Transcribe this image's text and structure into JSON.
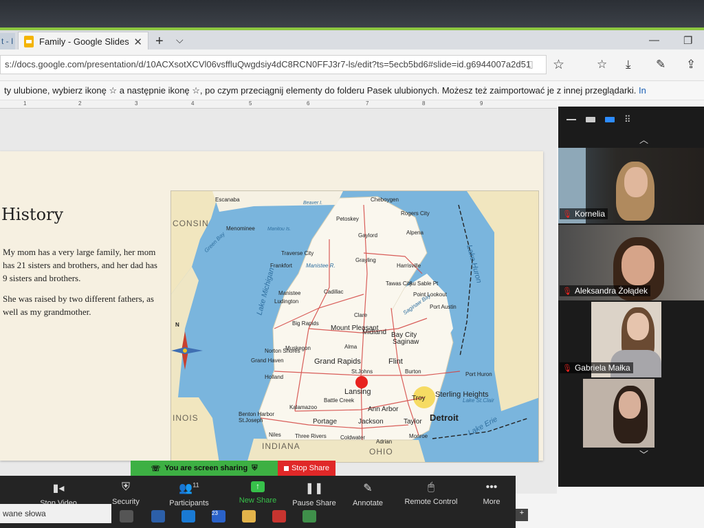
{
  "browser": {
    "tab_stub": "t - I",
    "tab_title": "Family - Google Slides",
    "tab_close": "✕",
    "new_tab": "+",
    "tab_menu": "⌵",
    "minimize": "—",
    "restore": "❐",
    "url": "s://docs.google.com/presentation/d/10ACXsotXCVl06vsffluQwgdsiy4dC8RCN0FFJ3r7-ls/edit?ts=5ecb5bd6#slide=id.g6944007a2d51",
    "favorites_hint": "ty ulubione, wybierz ikonę ☆ a następnie ikonę ☆, po czym przeciągnij elementy do folderu Pasek ulubionych. Możesz też zaimportować je z innej przeglądarki.",
    "favorites_link": "In",
    "icons": [
      "star-icon",
      "favorites-icon",
      "download-icon",
      "pen-icon",
      "share-icon"
    ]
  },
  "ruler": {
    "marks": [
      "1",
      "2",
      "3",
      "4",
      "5",
      "6",
      "7",
      "8",
      "9"
    ]
  },
  "slide": {
    "title": "History",
    "paragraph1": "My mom has a very large family, her mom has 21 sisters and brothers, and her dad has 9 sisters and brothers.",
    "paragraph2": "She was raised by two different fathers, as well as my grandmother."
  },
  "map": {
    "cities": [
      "Cheboygen",
      "Rogers City",
      "Petoskey",
      "Gaylord",
      "Alpena",
      "Traverse City",
      "Grayling",
      "Harrisville",
      "Frankfort",
      "Cadillac",
      "Tawas City",
      "Manistee",
      "Ludington",
      "Big Rapids",
      "Clare",
      "Mount Pleasant",
      "Midland",
      "Bay City",
      "Saginaw",
      "Norton Shores",
      "Grand Haven",
      "Muskegon",
      "Grand Rapids",
      "Flint",
      "Burton",
      "Holland",
      "St.Johns",
      "Lansing",
      "Port Huron",
      "Sterling Heights",
      "Troy",
      "Detroit",
      "Battle Creek",
      "Kalamazoo",
      "Ann Arbor",
      "Benton Harbor St.Joseph",
      "Portage",
      "Jackson",
      "Taylor",
      "Niles",
      "Three Rivers",
      "Coldwater",
      "Adrian",
      "Monroe",
      "Menominee",
      "Escanaba",
      "Alma",
      "Au Sable Pt",
      "Port Austin",
      "Point Lookout"
    ],
    "water": [
      "Lake Michigan",
      "Lake Huron",
      "Lake Erie",
      "Lake St.Clair",
      "Green Bay",
      "Manistee R.",
      "Saginaw Bay",
      "Manitou Is.",
      "Beaver I."
    ],
    "states": [
      "CONSIN",
      "INOIS",
      "INDIANA",
      "OHIO"
    ],
    "compass": "N",
    "highlighted_city": "Lansing"
  },
  "zoom": {
    "view_icons": [
      "minimize-icon",
      "speaker-view-icon",
      "active-gallery-icon",
      "grid-view-icon"
    ],
    "participants": [
      {
        "name": "Kornelia",
        "muted": true
      },
      {
        "name": "Aleksandra Żołądek",
        "muted": true
      },
      {
        "name": "Gabriela Małka",
        "muted": true
      },
      {
        "name": "",
        "muted": false
      }
    ],
    "banner_sharing": "You are screen sharing",
    "banner_stop": "Stop Share",
    "toolbar": {
      "stop_video": "Stop Video",
      "security": "Security",
      "participants": "Participants",
      "participants_count": "11",
      "new_share": "New Share",
      "pause_share": "Pause Share",
      "annotate": "Annotate",
      "remote_control": "Remote Control",
      "more": "More"
    }
  },
  "taskbar": {
    "search_text": "wane słowa",
    "badge": "23"
  },
  "colors": {
    "accent_green": "#3db043",
    "stop_red": "#e02828",
    "lansing_red": "#e8231f",
    "link_blue": "#1a5fb4"
  }
}
